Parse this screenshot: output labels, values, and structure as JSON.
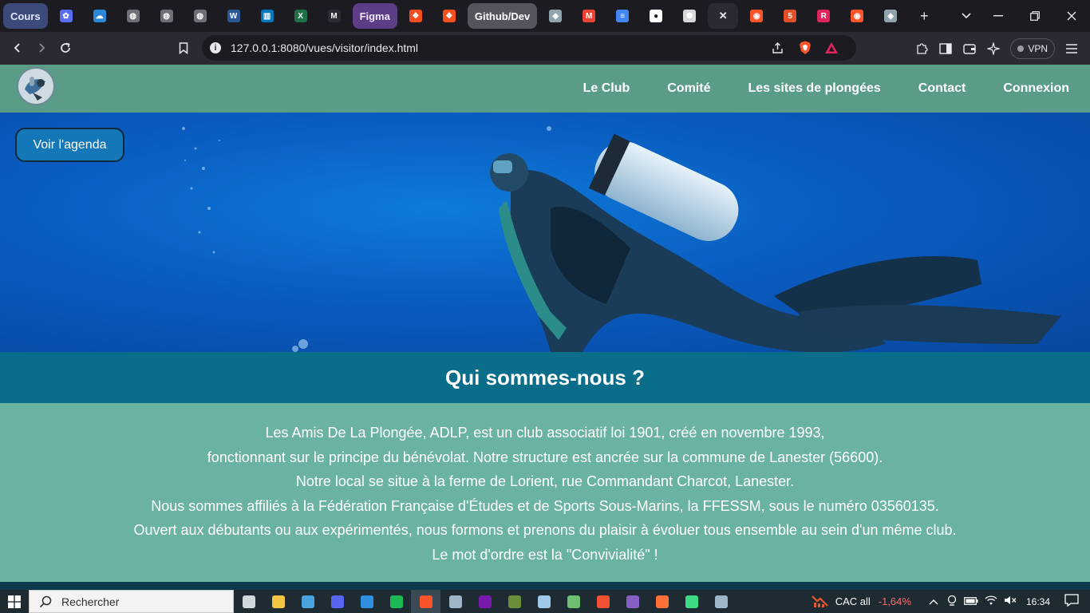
{
  "browser": {
    "tabs": [
      {
        "type": "group",
        "label": "Cours",
        "bg": "#3b4a78",
        "color": "#dfe6ff"
      },
      {
        "type": "icon",
        "icon": "bird-icon",
        "fav": "#5a6cf0",
        "glyph": "✿"
      },
      {
        "type": "icon",
        "icon": "onedrive-icon",
        "fav": "#2b88d8",
        "glyph": "☁"
      },
      {
        "type": "icon",
        "icon": "globe-icon",
        "fav": "#6e6e76",
        "glyph": "◍"
      },
      {
        "type": "icon",
        "icon": "globe-icon",
        "fav": "#6e6e76",
        "glyph": "◍"
      },
      {
        "type": "icon",
        "icon": "globe-icon",
        "fav": "#6e6e76",
        "glyph": "◍"
      },
      {
        "type": "icon",
        "icon": "word-icon",
        "fav": "#2b5797",
        "glyph": "W"
      },
      {
        "type": "icon",
        "icon": "trello-icon",
        "fav": "#0079bf",
        "glyph": "▥"
      },
      {
        "type": "icon",
        "icon": "excel-icon",
        "fav": "#1e7145",
        "glyph": "X"
      },
      {
        "type": "icon",
        "icon": "medium-icon",
        "fav": "#2b2a33",
        "glyph": "M"
      },
      {
        "type": "group",
        "label": "Figma",
        "bg": "#5b3e86",
        "color": "#f0e6ff"
      },
      {
        "type": "icon",
        "icon": "figma-icon",
        "fav": "#f24e1e",
        "glyph": "❖"
      },
      {
        "type": "icon",
        "icon": "figma-icon",
        "fav": "#f24e1e",
        "glyph": "❖"
      },
      {
        "type": "group",
        "label": "Github/Dev",
        "bg": "#55545c",
        "color": "#ffffff"
      },
      {
        "type": "icon",
        "icon": "diver-logo-icon",
        "fav": "#8fa3ad",
        "glyph": "◈"
      },
      {
        "type": "icon",
        "icon": "gmail-icon",
        "fav": "#ea4335",
        "glyph": "M"
      },
      {
        "type": "icon",
        "icon": "docs-icon",
        "fav": "#4285f4",
        "glyph": "≡"
      },
      {
        "type": "icon",
        "icon": "github-icon",
        "fav": "#ffffff",
        "glyph": "●"
      },
      {
        "type": "icon",
        "icon": "openai-icon",
        "fav": "#d9d9d9",
        "glyph": "✺"
      },
      {
        "type": "icon",
        "icon": "close-icon",
        "fav": "transparent",
        "glyph": "✕",
        "active": true
      },
      {
        "type": "icon",
        "icon": "brave-shield-icon",
        "fav": "#fb542b",
        "glyph": "◉"
      },
      {
        "type": "icon",
        "icon": "html5-icon",
        "fav": "#e34f26",
        "glyph": "5"
      },
      {
        "type": "icon",
        "icon": "r-app-icon",
        "fav": "#e0245e",
        "glyph": "R"
      },
      {
        "type": "icon",
        "icon": "brave-shield-icon",
        "fav": "#fb542b",
        "glyph": "◉"
      },
      {
        "type": "icon",
        "icon": "diver-logo-icon",
        "fav": "#8fa3ad",
        "glyph": "◈"
      }
    ],
    "new_tab": "+",
    "url": "127.0.0.1:8080/vues/visitor/index.html",
    "vpn_label": "VPN"
  },
  "site": {
    "nav": [
      "Le Club",
      "Comité",
      "Les sites de plongées",
      "Contact",
      "Connexion"
    ],
    "agenda_button": "Voir l'agenda",
    "section_title": "Qui sommes-nous ?",
    "paragraph_lines": [
      "Les Amis De La Plongée, ADLP, est un club associatif loi 1901, créé en novembre 1993,",
      "fonctionnant sur le principe du bénévolat. Notre structure est ancrée sur la commune de Lanester (56600).",
      "Notre local se situe à la ferme de Lorient, rue Commandant Charcot, Lanester.",
      "Nous sommes affiliés à la Fédération Française d'Études et de Sports Sous-Marins, la FFESSM, sous le numéro 03560135.",
      "Ouvert aux débutants ou aux expérimentés, nous formons et prenons du plaisir à évoluer tous ensemble au sein d'un même club.",
      "Le mot d'ordre est la \"Convivialité\" !"
    ]
  },
  "taskbar": {
    "search_placeholder": "Rechercher",
    "apps": [
      {
        "icon": "task-view-icon",
        "color": "#cfd8dc"
      },
      {
        "icon": "file-explorer-icon",
        "color": "#f4c542"
      },
      {
        "icon": "store-icon",
        "color": "#4aa3df"
      },
      {
        "icon": "discord-icon",
        "color": "#5865f2"
      },
      {
        "icon": "vscode-icon",
        "color": "#2f8fe0"
      },
      {
        "icon": "spotify-icon",
        "color": "#1db954"
      },
      {
        "icon": "brave-icon",
        "color": "#fb542b",
        "active": true
      },
      {
        "icon": "steam-icon",
        "color": "#9fb6c8"
      },
      {
        "icon": "onenote-icon",
        "color": "#7719aa"
      },
      {
        "icon": "minecraft-icon",
        "color": "#6b8e3a"
      },
      {
        "icon": "box-app-icon",
        "color": "#9ec9e8"
      },
      {
        "icon": "terminal-icon",
        "color": "#6fbf73"
      },
      {
        "icon": "git-app-icon",
        "color": "#f05133"
      },
      {
        "icon": "visual-studio-icon",
        "color": "#865fc5"
      },
      {
        "icon": "firefox-icon",
        "color": "#ff7139"
      },
      {
        "icon": "android-studio-icon",
        "color": "#3ddc84"
      },
      {
        "icon": "vm-app-icon",
        "color": "#9fb6c8"
      }
    ],
    "stock_name": "CAC all",
    "stock_change": "-1,64%",
    "time": "16:34"
  }
}
